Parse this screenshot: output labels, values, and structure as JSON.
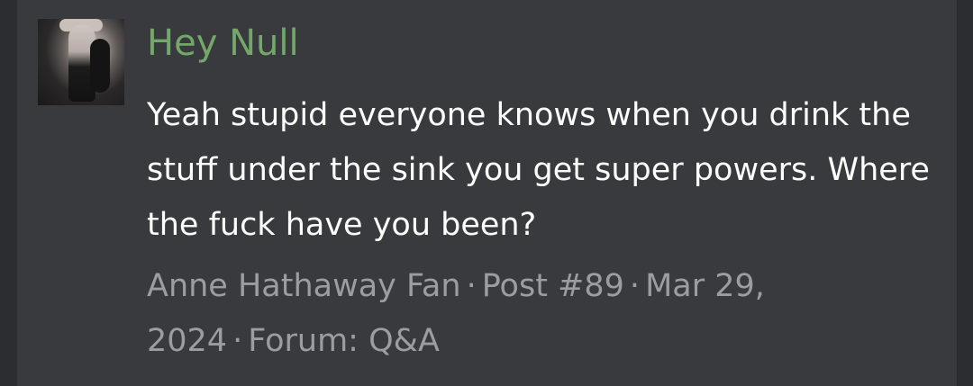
{
  "post": {
    "author_display": "Hey Null",
    "body": "Yeah stupid everyone knows when you drink the stuff under the sink you get super powers. Where the fuck have you been?",
    "meta": {
      "user": "Anne Hathaway Fan",
      "separator": "·",
      "post_number": "Post #89",
      "date": "Mar 29, 2024",
      "forum": "Forum: Q&A"
    }
  },
  "colors": {
    "page_background": "#2b2d30",
    "card_background": "#383a3e",
    "username": "#73a86a",
    "body_text": "#ffffff",
    "meta_text": "#9a9da2"
  }
}
